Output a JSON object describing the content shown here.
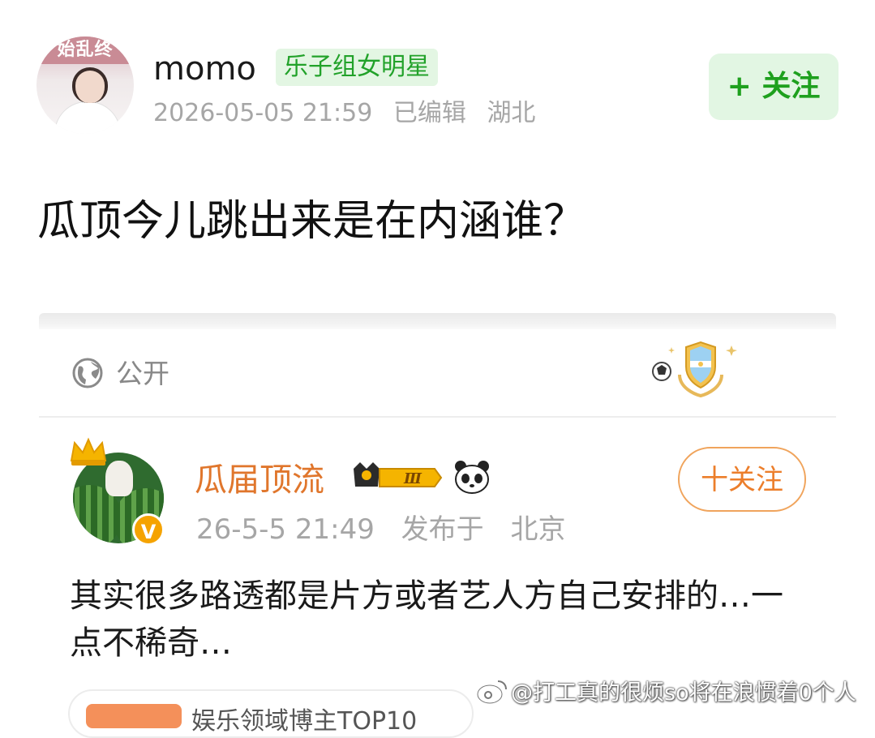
{
  "post": {
    "avatar_overlay_text": "始乱终",
    "username": "momo",
    "tag": "乐子组女明星",
    "timestamp": "2026-05-05 21:59",
    "edited_label": "已编辑",
    "location": "湖北",
    "follow_label": "+ 关注",
    "title": "瓜顶今儿跳出来是在内涵谁？"
  },
  "visibility": {
    "label": "公开",
    "icon": "globe-icon"
  },
  "embedded_post": {
    "username": "瓜届顶流",
    "level": "Ⅲ",
    "verified_icon": "v-badge-icon",
    "timestamp": "26-5-5 21:49",
    "published_label": "发布于",
    "location": "北京",
    "follow_label": "十关注",
    "content": "其实很多路透都是片方或者艺人方自己安排的…一点不稀奇…",
    "bottom_card_text": "娱乐领域博主TOP10"
  },
  "watermark": {
    "text": "@打工真的很烦so将在浪惯着0个人"
  },
  "colors": {
    "follow_green": "#1ea01e",
    "tag_green": "#22a22a",
    "embedded_username_orange": "#e0762c",
    "follow_orange": "#ec7e2b",
    "meta_gray": "#a6a6a6"
  }
}
